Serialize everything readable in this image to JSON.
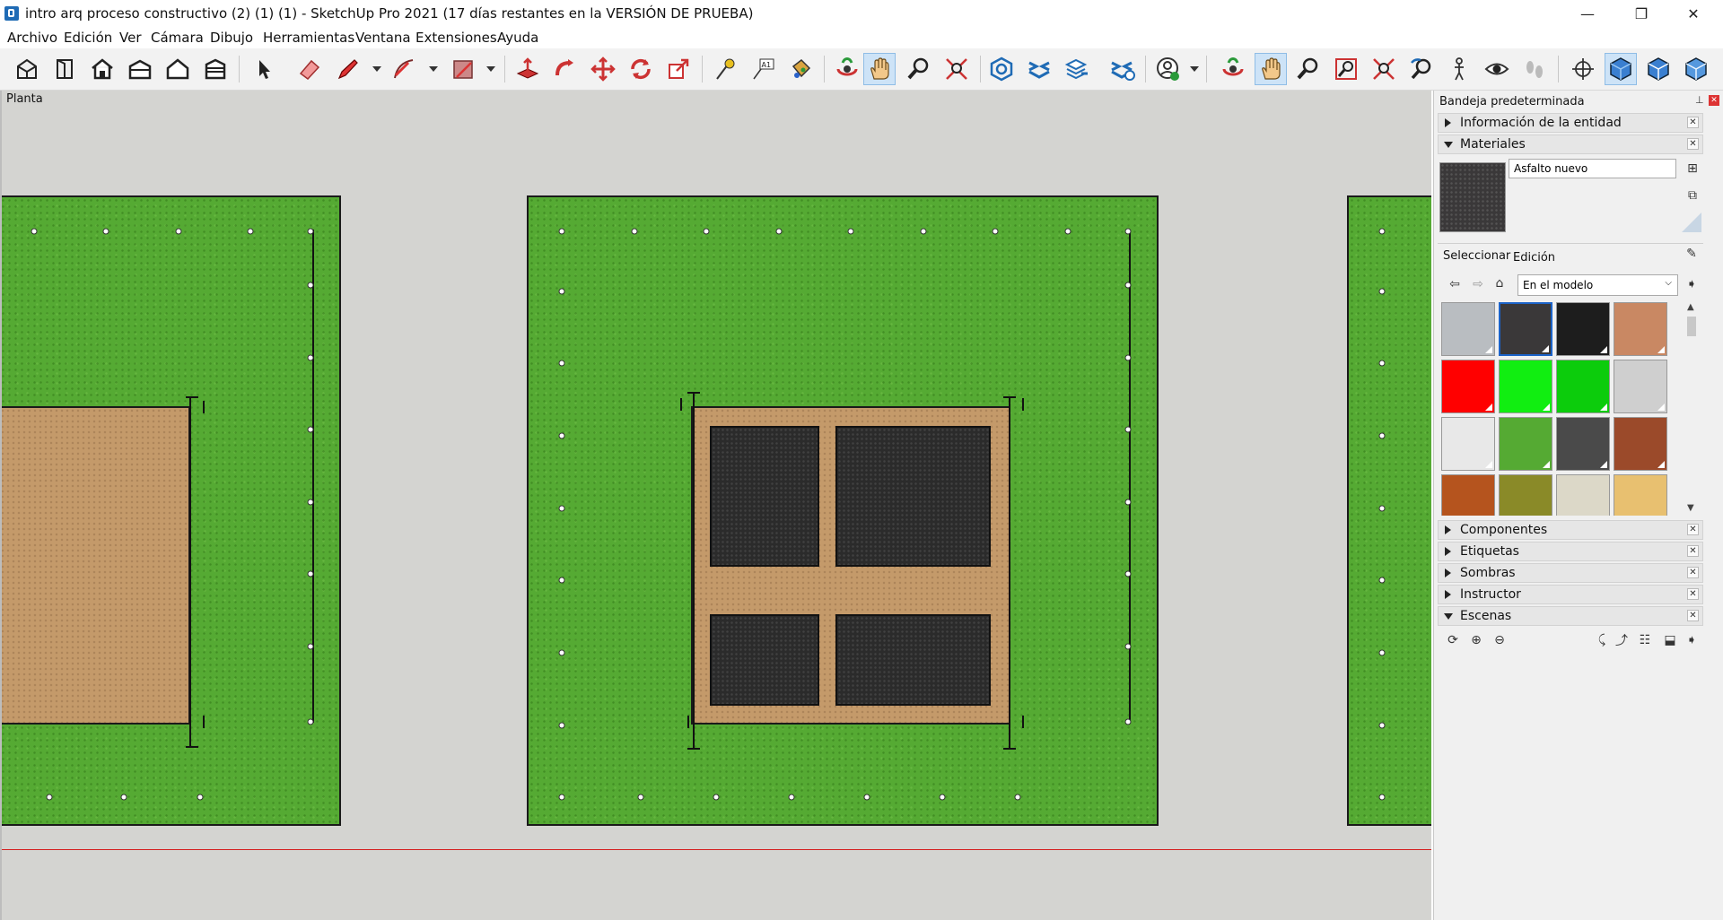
{
  "window": {
    "title": "intro arq proceso constructivo (2) (1) (1) - SketchUp Pro 2021 (17 días restantes en la VERSIÓN DE PRUEBA)",
    "minimize": "—",
    "restore": "❐",
    "close": "✕"
  },
  "menu": [
    "Archivo",
    "Edición",
    "Ver",
    "Cámara",
    "Dibujo",
    "Herramientas",
    "Ventana",
    "Extensiones",
    "Ayuda"
  ],
  "viewport": {
    "view_name": "Planta",
    "colors": {
      "grass": "#55aa33",
      "dirt": "#c49a6a",
      "asphalt": "#2b2b2b",
      "background": "#d4d4d1",
      "red_axis": "#d42020"
    }
  },
  "tray": {
    "title": "Bandeja predeterminada",
    "sections": {
      "entity_info": "Información de la entidad",
      "materials": "Materiales",
      "components": "Componentes",
      "tags": "Etiquetas",
      "shadows": "Sombras",
      "instructor": "Instructor",
      "scenes": "Escenas"
    },
    "materials": {
      "current_name": "Asfalto nuevo",
      "tab_select": "Seleccionar",
      "tab_edit": "Edición",
      "collection": "En el modelo",
      "swatch_colors": [
        "#b9bdc1",
        "#3a3839",
        "#1d1d1d",
        "#c98863",
        "#ff0000",
        "#11ee11",
        "#0ccc0c",
        "#cfcfcf",
        "#e8e8e8",
        "#55aa33",
        "#4a4a4a",
        "#9b4a2a",
        "#b5541e",
        "#8a8a28",
        "#dcd8c8",
        "#e8c070"
      ],
      "selected_index": 1
    }
  }
}
